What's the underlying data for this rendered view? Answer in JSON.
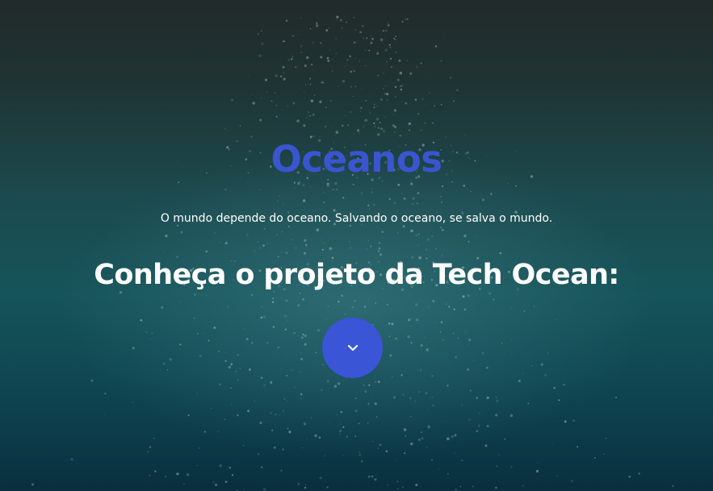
{
  "hero": {
    "title": "Oceanos",
    "subtitle": "O mundo depende do oceano. Salvando o oceano, se salva o mundo.",
    "heading": "Conheça o projeto da Tech Ocean:",
    "scroll_button_icon": "chevron-down-icon"
  },
  "colors": {
    "title": "#3a55cf",
    "button": "#3a55d6",
    "text": "#ffffff"
  }
}
